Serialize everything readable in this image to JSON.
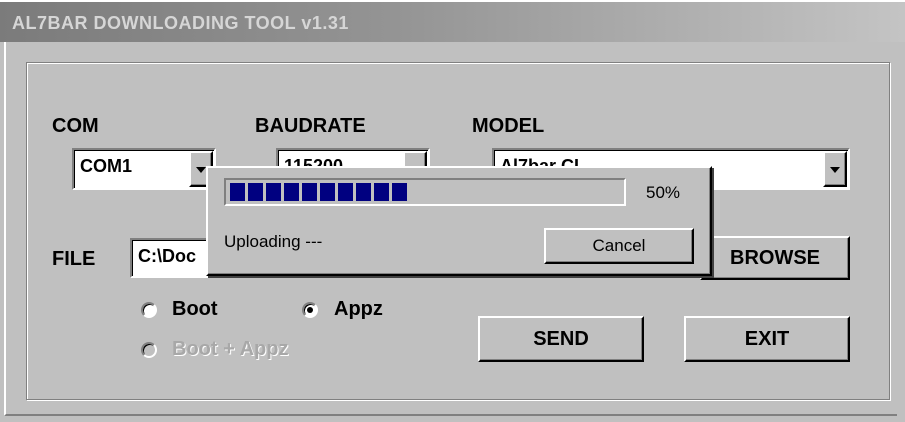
{
  "window": {
    "title": "AL7BAR DOWNLOADING TOOL v1.31"
  },
  "form": {
    "com_label": "COM",
    "com_value": "COM1",
    "baudrate_label": "BAUDRATE",
    "baudrate_value": "115200",
    "model_label": "MODEL",
    "model_value": "Al7bar CL",
    "file_label": "FILE",
    "file_value": "C:\\Doc",
    "browse_label": "BROWSE",
    "radios": [
      {
        "label": "Boot",
        "checked": false,
        "enabled": true
      },
      {
        "label": "Appz",
        "checked": true,
        "enabled": true
      },
      {
        "label": "Boot + Appz",
        "checked": false,
        "enabled": false
      }
    ],
    "send_label": "SEND",
    "exit_label": "EXIT"
  },
  "progress_dialog": {
    "percent_text": "50%",
    "progress_fraction": 0.5,
    "segments_filled": 10,
    "status_text": "Uploading ---",
    "cancel_label": "Cancel",
    "bar_color": "#000080"
  }
}
